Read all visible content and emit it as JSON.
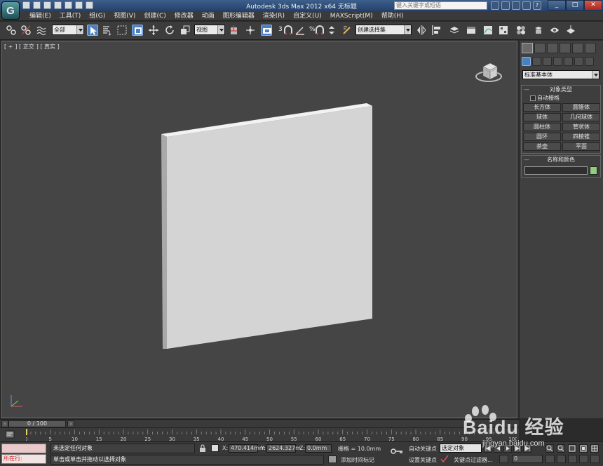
{
  "titlebar": {
    "title": "Autodesk 3ds Max  2012 x64      无标题",
    "search_placeholder": "键入关键字或短语"
  },
  "menus": [
    "编辑(E)",
    "工具(T)",
    "组(G)",
    "视图(V)",
    "创建(C)",
    "修改器",
    "动画",
    "图形编辑器",
    "渲染(R)",
    "自定义(U)",
    "MAXScript(M)",
    "帮助(H)"
  ],
  "toolbar": {
    "selection_filter": "全部",
    "reference_coord": "视图",
    "named_selection": "创建选择集",
    "snap_3": "3",
    "snap_percent": "%"
  },
  "viewport": {
    "labels": [
      "[ +",
      "] [ 正交",
      "] [ 真实 ]"
    ],
    "background": "#454545"
  },
  "command_panel": {
    "category": "标准基本体",
    "object_type_title": "对象类型",
    "autogrid_label": "自动栅格",
    "objects": [
      "长方体",
      "圆锥体",
      "球体",
      "几何球体",
      "圆柱体",
      "管状体",
      "圆环",
      "四棱锥",
      "茶壶",
      "平面"
    ],
    "name_color_title": "名称和颜色",
    "object_color": "#8fd07e"
  },
  "timeline": {
    "slider_text": "0 / 100",
    "ticks": [
      0,
      5,
      10,
      15,
      20,
      25,
      30,
      35,
      40,
      45,
      50,
      55,
      60,
      65,
      70,
      75,
      80,
      85,
      90,
      95,
      100
    ]
  },
  "status": {
    "running_label": "所在行:",
    "selection_text": "未选定任何对象",
    "prompt_text": "单击或单击并拖动以选择对象",
    "x_label": "X:",
    "x_value": "470.414mm",
    "y_label": "Y:",
    "y_value": "2624.327m",
    "z_label": "Z:",
    "z_value": "0.0mm",
    "grid_label": "栅格 = 10.0mm",
    "add_time_tag": "添加时间标记",
    "auto_key": "自动关键点",
    "set_key": "设置关键点",
    "selected_combo": "选定对象",
    "key_filters": "关键点过滤器...",
    "frame_value": "0"
  },
  "watermark": {
    "brand_text": "Baidu 经验",
    "url_text": "jingyan.baidu.com"
  }
}
